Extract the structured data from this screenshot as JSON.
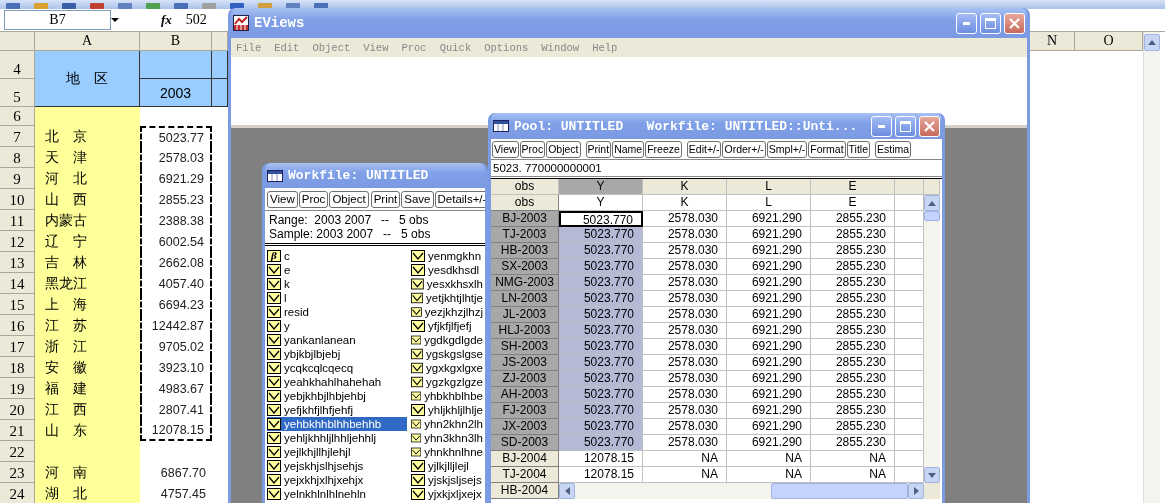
{
  "spreadsheet": {
    "name_box": "B7",
    "function_label": "fx",
    "formula": "502",
    "columns": [
      {
        "letter": "A"
      },
      {
        "letter": "B"
      },
      {
        "letter": "N"
      },
      {
        "letter": "O"
      }
    ],
    "header": {
      "row_numbers": [
        "4",
        "5"
      ],
      "region_label": "地　区",
      "year": "2003"
    },
    "rows": [
      {
        "number": "6",
        "copied": false
      },
      {
        "number": "7",
        "region": "北　京",
        "value": "5023.77",
        "copied": true
      },
      {
        "number": "8",
        "region": "天　津",
        "value": "2578.03",
        "copied": true
      },
      {
        "number": "9",
        "region": "河　北",
        "value": "6921.29",
        "copied": true
      },
      {
        "number": "10",
        "region": "山　西",
        "value": "2855.23",
        "copied": true
      },
      {
        "number": "11",
        "region": "内蒙古",
        "value": "2388.38",
        "copied": true
      },
      {
        "number": "12",
        "region": "辽　宁",
        "value": "6002.54",
        "copied": true
      },
      {
        "number": "13",
        "region": "吉　林",
        "value": "2662.08",
        "copied": true
      },
      {
        "number": "14",
        "region": "黑龙江",
        "value": "4057.40",
        "copied": true
      },
      {
        "number": "15",
        "region": "上　海",
        "value": "6694.23",
        "copied": true
      },
      {
        "number": "16",
        "region": "江　苏",
        "value": "12442.87",
        "copied": true
      },
      {
        "number": "17",
        "region": "浙　江",
        "value": "9705.02",
        "copied": true
      },
      {
        "number": "18",
        "region": "安　徽",
        "value": "3923.10",
        "copied": true
      },
      {
        "number": "19",
        "region": "福　建",
        "value": "4983.67",
        "copied": true
      },
      {
        "number": "20",
        "region": "江　西",
        "value": "2807.41",
        "copied": true
      },
      {
        "number": "21",
        "region": "山　东",
        "value": "12078.15",
        "copied": true
      },
      {
        "number": "22",
        "copied": false
      },
      {
        "number": "23",
        "region": "河　南",
        "value": "6867.70",
        "copied": false
      },
      {
        "number": "24",
        "region": "湖　北",
        "value": "4757.45",
        "copied": false
      }
    ]
  },
  "eviews": {
    "title": "EViews",
    "menu": [
      "File",
      "Edit",
      "Object",
      "View",
      "Proc",
      "Quick",
      "Options",
      "Window",
      "Help"
    ]
  },
  "workfile": {
    "title": "Workfile: UNTITLED",
    "buttons": [
      "View",
      "Proc",
      "Object",
      "Print",
      "Save",
      "Details+/-"
    ],
    "range": "Range:  2003 2007   --   5 obs",
    "sample": "Sample: 2003 2007   --   5 obs",
    "objects": [
      {
        "name": "c",
        "kind": "coef",
        "icon_label": "β",
        "selected": false
      },
      {
        "name": "e",
        "kind": "series",
        "selected": false
      },
      {
        "name": "k",
        "kind": "series",
        "selected": false
      },
      {
        "name": "l",
        "kind": "series",
        "selected": false
      },
      {
        "name": "resid",
        "kind": "series",
        "selected": false
      },
      {
        "name": "y",
        "kind": "series",
        "selected": false
      },
      {
        "name": "yankanlanean",
        "kind": "series",
        "selected": false
      },
      {
        "name": "ybjkbjlbjebj",
        "kind": "series",
        "selected": false
      },
      {
        "name": "ycqkcqlcqecq",
        "kind": "series",
        "selected": false
      },
      {
        "name": "yeahkhahlhahehah",
        "kind": "series",
        "selected": false
      },
      {
        "name": "yebjkhbjlhbjehbj",
        "kind": "series",
        "selected": false
      },
      {
        "name": "yefjkhfjlhfjehfj",
        "kind": "series",
        "selected": false
      },
      {
        "name": "yehbkhhblhhbehhb",
        "kind": "series",
        "selected": true
      },
      {
        "name": "yehljkhhljlhhljehhlj",
        "kind": "series",
        "selected": false
      },
      {
        "name": "yejlkhjllhjlehjl",
        "kind": "series",
        "selected": false
      },
      {
        "name": "yejskhjslhjsehjs",
        "kind": "series",
        "selected": false
      },
      {
        "name": "yejxkhjxlhjxehjx",
        "kind": "series",
        "selected": false
      },
      {
        "name": "yelnkhlnlhlnehln",
        "kind": "series",
        "selected": false
      },
      {
        "name": "yenmgkhn",
        "kind": "series",
        "selected": false
      },
      {
        "name": "yesdkhsdl",
        "kind": "series",
        "selected": false
      },
      {
        "name": "yesxkhsxlh",
        "kind": "series",
        "selected": false
      },
      {
        "name": "yetjkhtjlhtje",
        "kind": "series",
        "selected": false
      },
      {
        "name": "yezjkhzjlhzj",
        "kind": "series",
        "selected": false
      },
      {
        "name": "yfjkfjlfjefj",
        "kind": "series",
        "selected": false
      },
      {
        "name": "ygdkgdlgde",
        "kind": "series",
        "selected": false
      },
      {
        "name": "ygskgslgse",
        "kind": "series",
        "selected": false
      },
      {
        "name": "ygxkgxlgxe",
        "kind": "series",
        "selected": false
      },
      {
        "name": "ygzkgzlgze",
        "kind": "series",
        "selected": false
      },
      {
        "name": "yhbkhblhbe",
        "kind": "series",
        "selected": false
      },
      {
        "name": "yhljkhljlhlje",
        "kind": "series",
        "selected": false
      },
      {
        "name": "yhn2khn2lh",
        "kind": "series",
        "selected": false
      },
      {
        "name": "yhn3khn3lh",
        "kind": "series",
        "selected": false
      },
      {
        "name": "yhnkhnlhne",
        "kind": "series",
        "selected": false
      },
      {
        "name": "yjlkjlljlejl",
        "kind": "series",
        "selected": false
      },
      {
        "name": "yjskjsljsejs",
        "kind": "series",
        "selected": false
      },
      {
        "name": "yjxkjxljxejx",
        "kind": "series",
        "selected": false
      }
    ]
  },
  "pool": {
    "title": "Pool: UNTITLED   Workfile: UNTITLED::Unti...",
    "button_groups": [
      [
        "View",
        "Proc",
        "Object"
      ],
      [
        "Print",
        "Name",
        "Freeze"
      ],
      [
        "Edit+/-",
        "Order+/-",
        "Smpl+/-",
        "Format",
        "Title"
      ],
      [
        "Estima"
      ]
    ],
    "edit_value": "5023. 770000000001",
    "columns": [
      {
        "label": "obs",
        "selected": false
      },
      {
        "label": "Y",
        "selected": true
      },
      {
        "label": "K",
        "selected": false
      },
      {
        "label": "L",
        "selected": false
      },
      {
        "label": "E",
        "selected": false
      }
    ],
    "names": [
      "obs",
      "Y",
      "K",
      "L",
      "E"
    ],
    "rows": [
      {
        "obs": "BJ-2003",
        "values": [
          "5023.770",
          "2578.030",
          "6921.290",
          "2855.230"
        ],
        "selected": true,
        "current": true
      },
      {
        "obs": "TJ-2003",
        "values": [
          "5023.770",
          "2578.030",
          "6921.290",
          "2855.230"
        ],
        "selected": true,
        "current": false
      },
      {
        "obs": "HB-2003",
        "values": [
          "5023.770",
          "2578.030",
          "6921.290",
          "2855.230"
        ],
        "selected": true,
        "current": false
      },
      {
        "obs": "SX-2003",
        "values": [
          "5023.770",
          "2578.030",
          "6921.290",
          "2855.230"
        ],
        "selected": true,
        "current": false
      },
      {
        "obs": "NMG-2003",
        "values": [
          "5023.770",
          "2578.030",
          "6921.290",
          "2855.230"
        ],
        "selected": true,
        "current": false
      },
      {
        "obs": "LN-2003",
        "values": [
          "5023.770",
          "2578.030",
          "6921.290",
          "2855.230"
        ],
        "selected": true,
        "current": false
      },
      {
        "obs": "JL-2003",
        "values": [
          "5023.770",
          "2578.030",
          "6921.290",
          "2855.230"
        ],
        "selected": true,
        "current": false
      },
      {
        "obs": "HLJ-2003",
        "values": [
          "5023.770",
          "2578.030",
          "6921.290",
          "2855.230"
        ],
        "selected": true,
        "current": false
      },
      {
        "obs": "SH-2003",
        "values": [
          "5023.770",
          "2578.030",
          "6921.290",
          "2855.230"
        ],
        "selected": true,
        "current": false
      },
      {
        "obs": "JS-2003",
        "values": [
          "5023.770",
          "2578.030",
          "6921.290",
          "2855.230"
        ],
        "selected": true,
        "current": false
      },
      {
        "obs": "ZJ-2003",
        "values": [
          "5023.770",
          "2578.030",
          "6921.290",
          "2855.230"
        ],
        "selected": true,
        "current": false
      },
      {
        "obs": "AH-2003",
        "values": [
          "5023.770",
          "2578.030",
          "6921.290",
          "2855.230"
        ],
        "selected": true,
        "current": false
      },
      {
        "obs": "FJ-2003",
        "values": [
          "5023.770",
          "2578.030",
          "6921.290",
          "2855.230"
        ],
        "selected": true,
        "current": false
      },
      {
        "obs": "JX-2003",
        "values": [
          "5023.770",
          "2578.030",
          "6921.290",
          "2855.230"
        ],
        "selected": true,
        "current": false
      },
      {
        "obs": "SD-2003",
        "values": [
          "5023.770",
          "2578.030",
          "6921.290",
          "2855.230"
        ],
        "selected": true,
        "current": false
      },
      {
        "obs": "BJ-2004",
        "values": [
          "12078.15",
          "NA",
          "NA",
          "NA"
        ],
        "selected": false,
        "current": false
      },
      {
        "obs": "TJ-2004",
        "values": [
          "12078.15",
          "NA",
          "NA",
          "NA"
        ],
        "selected": false,
        "current": false
      }
    ],
    "partial_row": {
      "obs": "HB-2004"
    }
  }
}
